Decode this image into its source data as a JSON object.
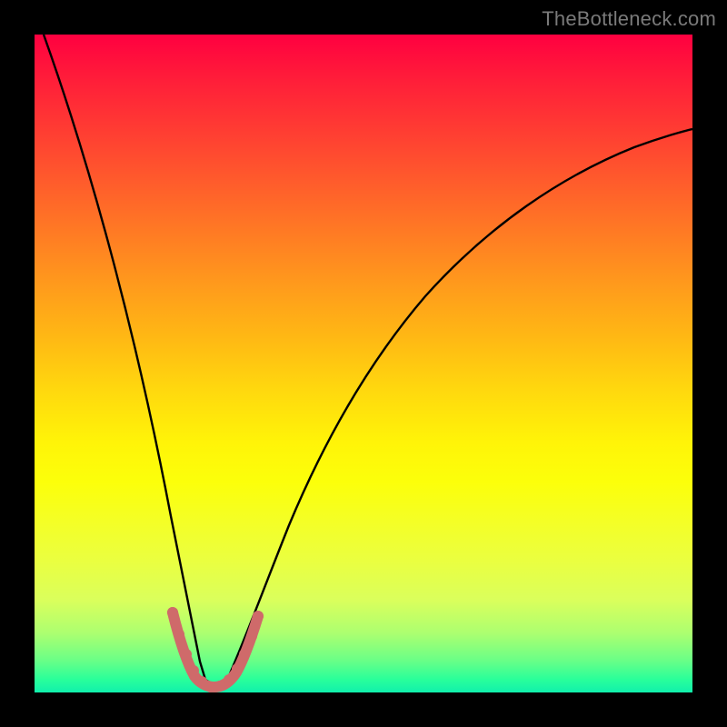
{
  "watermark": {
    "text": "TheBottleneck.com"
  },
  "chart_data": {
    "type": "line",
    "title": "",
    "xlabel": "",
    "ylabel": "",
    "xlim": [
      0,
      100
    ],
    "ylim": [
      0,
      100
    ],
    "grid": false,
    "annotations": [],
    "series": [
      {
        "name": "bottleneck-curve",
        "color": "#000000",
        "x": [
          0,
          5,
          10,
          15,
          20,
          23.5,
          25,
          27,
          30,
          32,
          35,
          40,
          45,
          50,
          55,
          60,
          65,
          70,
          75,
          80,
          85,
          90,
          95,
          100
        ],
        "y": [
          100,
          84,
          67,
          49,
          28,
          10,
          3,
          0,
          3,
          10,
          22,
          38,
          49,
          56,
          62,
          66,
          70,
          73,
          76,
          78,
          80,
          81.5,
          82.8,
          84
        ]
      },
      {
        "name": "highlight-band",
        "color": "#d46a6a",
        "x": [
          20.5,
          21.5,
          22.5,
          23.5,
          24.5,
          25.5,
          26.5,
          27.5,
          28.5,
          29.5,
          30.5,
          31.5,
          32.5
        ],
        "y": [
          12,
          9,
          6,
          3.5,
          1.8,
          1,
          1,
          1.4,
          3,
          5,
          7.5,
          10,
          12.5
        ]
      }
    ],
    "background_gradient": {
      "top": "#ff0040",
      "bottom": "#10f0ac"
    }
  }
}
